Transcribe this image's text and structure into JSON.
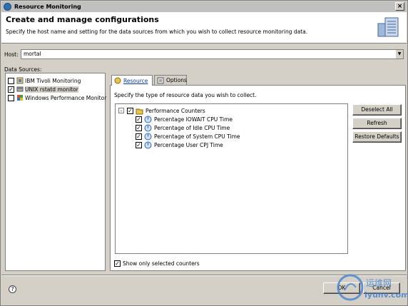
{
  "window": {
    "title": "Resource Monitoring",
    "close_label": "×"
  },
  "header": {
    "title": "Create and manage configurations",
    "description": "Specify the host name and setting for the data sources from which you wish to collect resource monitoring data."
  },
  "host": {
    "label": "Host:",
    "value": "mortal"
  },
  "data_sources": {
    "label": "Data Sources:",
    "items": [
      {
        "label": "IBM Tivoli Monitoring",
        "checked": false,
        "selected": false
      },
      {
        "label": "UNIX rstatd monitor",
        "checked": true,
        "selected": true
      },
      {
        "label": "Windows Performance Monitor",
        "checked": false,
        "selected": false
      }
    ]
  },
  "tabs": [
    {
      "label": "Resource",
      "active": true
    },
    {
      "label": "Options",
      "active": false
    }
  ],
  "resource": {
    "description": "Specify the type of resource data you wish to collect.",
    "root": {
      "label": "Performance Counters",
      "checked": true,
      "expander": "–"
    },
    "counters": [
      {
        "label": "Percentage IOWAIT CPU Time",
        "checked": true
      },
      {
        "label": "Percentage of Idle CPU Time",
        "checked": true
      },
      {
        "label": "Percentage of System CPU Time",
        "checked": true
      },
      {
        "label": "Percentage User CPJ Time",
        "checked": true
      }
    ],
    "buttons": {
      "deselect_all": "Deselect All",
      "refresh": "Refresh",
      "restore_defaults": "Restore Defaults"
    },
    "show_only_selected": {
      "label": "Show only selected counters",
      "checked": true
    }
  },
  "footer": {
    "ok": "OK",
    "cancel": "Cancel",
    "help_glyph": "?"
  },
  "watermark": {
    "line1": "运维网",
    "line2": "iyunv.com"
  },
  "colors": {
    "link_tab": "#0a3c9e",
    "counter_icon": "#2a66b0",
    "folder": "#e8c44a"
  },
  "icons": {
    "app": "app-icon",
    "header": "server-icon",
    "help": "help-icon",
    "ds_tivoli": "tivoli-icon",
    "ds_unix": "unix-icon",
    "ds_windows": "windows-icon",
    "counter": "counter-icon",
    "folder": "folder-icon"
  }
}
